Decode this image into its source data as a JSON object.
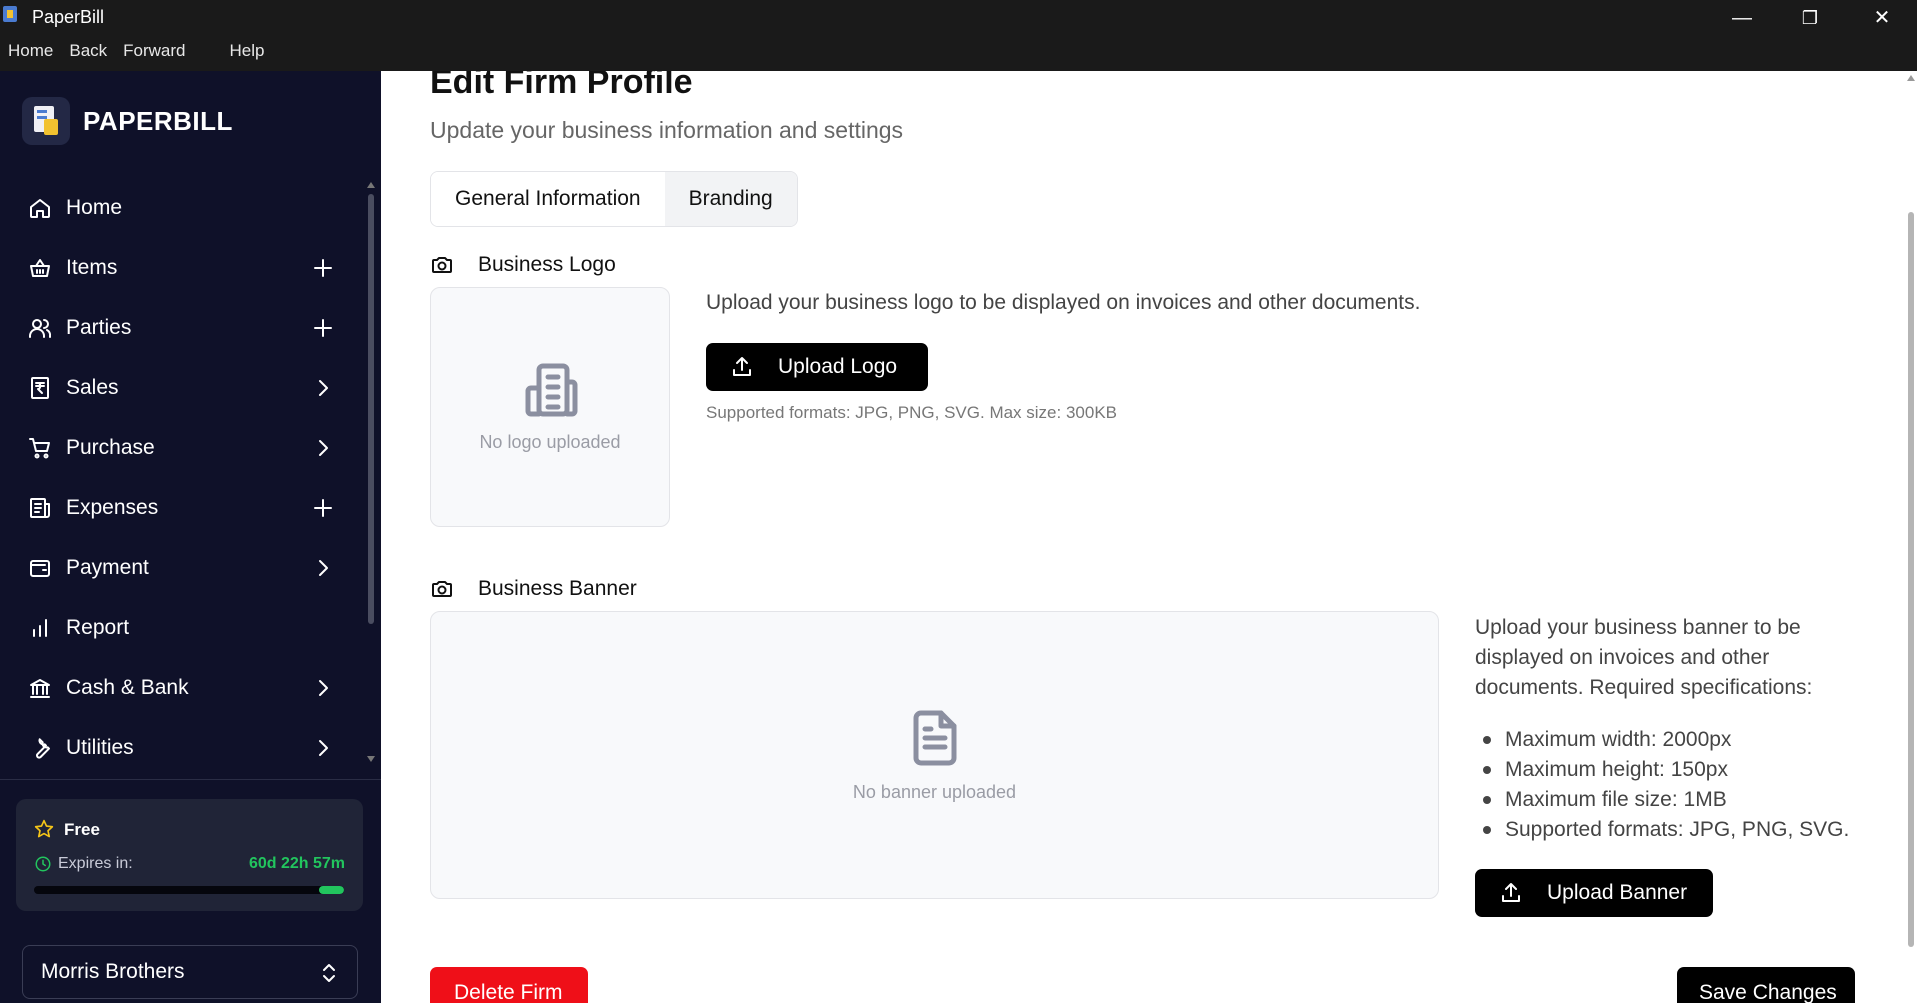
{
  "window": {
    "title": "PaperBill",
    "controls": {
      "minimize": "—",
      "maximize": "❐",
      "close": "✕"
    }
  },
  "menu": {
    "items": [
      "Home",
      "Back",
      "Forward",
      "Help"
    ]
  },
  "sidebar": {
    "brand": "PAPERBILL",
    "items": [
      {
        "label": "Home",
        "icon": "home-icon",
        "action": ""
      },
      {
        "label": "Items",
        "icon": "basket-icon",
        "action": "plus"
      },
      {
        "label": "Parties",
        "icon": "users-icon",
        "action": "plus"
      },
      {
        "label": "Sales",
        "icon": "receipt-icon",
        "action": "chevron"
      },
      {
        "label": "Purchase",
        "icon": "cart-icon",
        "action": "chevron"
      },
      {
        "label": "Expenses",
        "icon": "expense-icon",
        "action": "plus"
      },
      {
        "label": "Payment",
        "icon": "wallet-icon",
        "action": "chevron"
      },
      {
        "label": "Report",
        "icon": "bar-chart-icon",
        "action": ""
      },
      {
        "label": "Cash & Bank",
        "icon": "bank-icon",
        "action": "chevron"
      },
      {
        "label": "Utilities",
        "icon": "wrench-icon",
        "action": "chevron"
      }
    ],
    "plan": {
      "name": "Free",
      "expires_label": "Expires in:",
      "expires_value": "60d 22h 57m",
      "remaining_fraction": 0.08
    },
    "firm": "Morris Brothers"
  },
  "main": {
    "title": "Edit Firm Profile",
    "subtitle": "Update your business information and settings",
    "tabs": [
      {
        "label": "General Information",
        "active": true
      },
      {
        "label": "Branding",
        "active": false
      }
    ],
    "logo": {
      "heading": "Business Logo",
      "placeholder": "No logo uploaded",
      "description": "Upload your business logo to be displayed on invoices and other documents.",
      "button": "Upload Logo",
      "formats": "Supported formats: JPG, PNG, SVG. Max size: 300KB"
    },
    "banner": {
      "heading": "Business Banner",
      "placeholder": "No banner uploaded",
      "description": "Upload your business banner to be displayed on invoices and other documents. Required specifications:",
      "specs": [
        "Maximum width: 2000px",
        "Maximum height: 150px",
        "Maximum file size: 1MB",
        "Supported formats: JPG, PNG, SVG."
      ],
      "button": "Upload Banner"
    },
    "delete_button": "Delete Firm",
    "save_button": "Save Changes"
  },
  "colors": {
    "sidebar_bg": "#0f1129",
    "accent_green": "#22c55e",
    "danger_red": "#ef0f18",
    "primary_black": "#000000"
  }
}
